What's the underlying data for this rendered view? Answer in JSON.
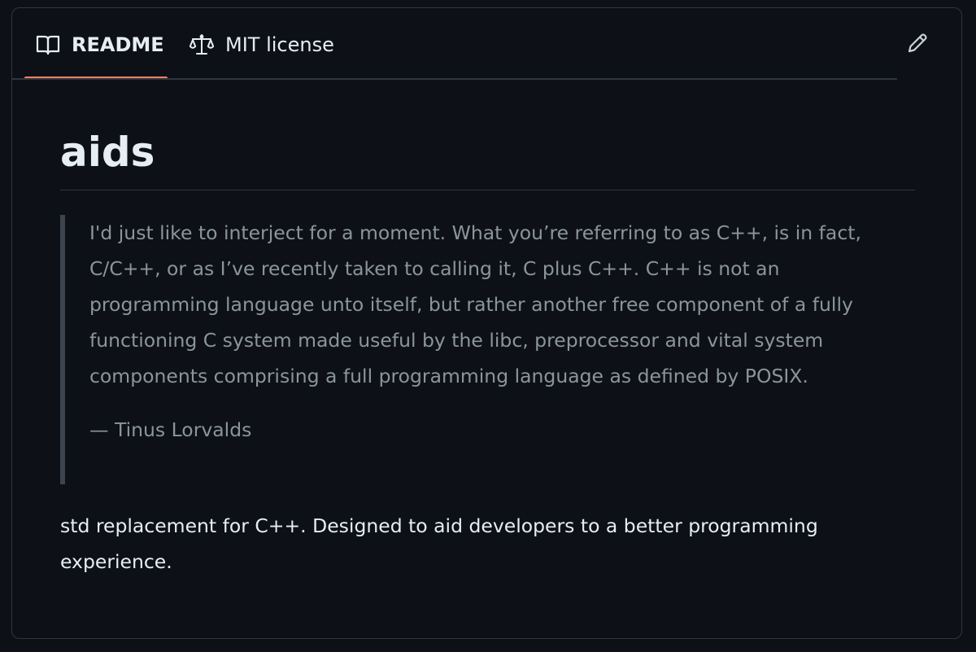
{
  "tabs": {
    "readme_label": "README",
    "license_label": "MIT license"
  },
  "icons": {
    "readme": "book-icon",
    "license": "scale-icon",
    "edit": "pencil-icon"
  },
  "colors": {
    "background": "#0d1117",
    "border": "#30363d",
    "active_tab_underline": "#f78166",
    "quote_text": "#8b949e"
  },
  "readme": {
    "title": "aids",
    "quote": {
      "text": "I'd just like to interject for a moment. What you’re referring to as C++, is in fact, C/C++, or as I’ve recently taken to calling it, C plus C++. C++ is not an programming language unto itself, but rather another free component of a fully functioning C system made useful by the libc, preprocessor and vital system components comprising a full programming language as defined by POSIX.",
      "author": "— Tinus Lorvalds"
    },
    "description": "std replacement for C++. Designed to aid developers to a better programming experience."
  }
}
